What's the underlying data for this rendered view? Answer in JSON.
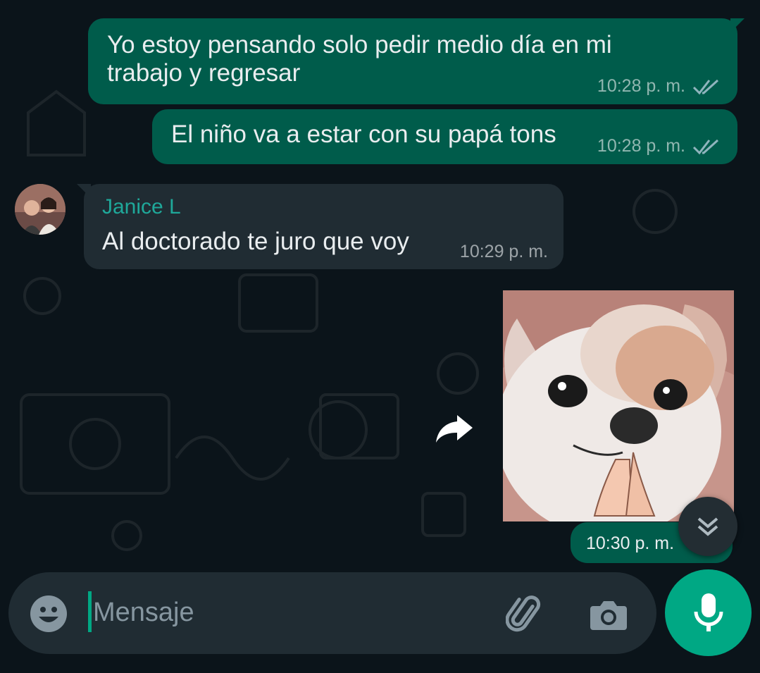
{
  "messages": [
    {
      "direction": "outgoing",
      "text_lines": [
        "Yo estoy pensando solo pedir medio día en mi",
        "trabajo y regresar"
      ],
      "time": "10:28 p. m.",
      "status": "read"
    },
    {
      "direction": "outgoing",
      "text": "El niño va a estar con su papá tons",
      "time": "10:28 p. m.",
      "status": "read"
    },
    {
      "direction": "incoming",
      "sender": "Janice L",
      "text": "Al doctorado te juro que voy",
      "time": "10:29 p. m."
    },
    {
      "direction": "outgoing",
      "type": "sticker",
      "time": "10:30 p. m."
    }
  ],
  "composer": {
    "placeholder": "Mensaje",
    "value": "",
    "icons": [
      "emoji-icon",
      "attach-icon",
      "camera-icon",
      "mic-icon"
    ]
  },
  "colors": {
    "background": "#0b141a",
    "outgoing_bubble": "#005c4b",
    "incoming_bubble": "#202c33",
    "sender_name": "#1fa89a",
    "accent": "#00a884"
  }
}
